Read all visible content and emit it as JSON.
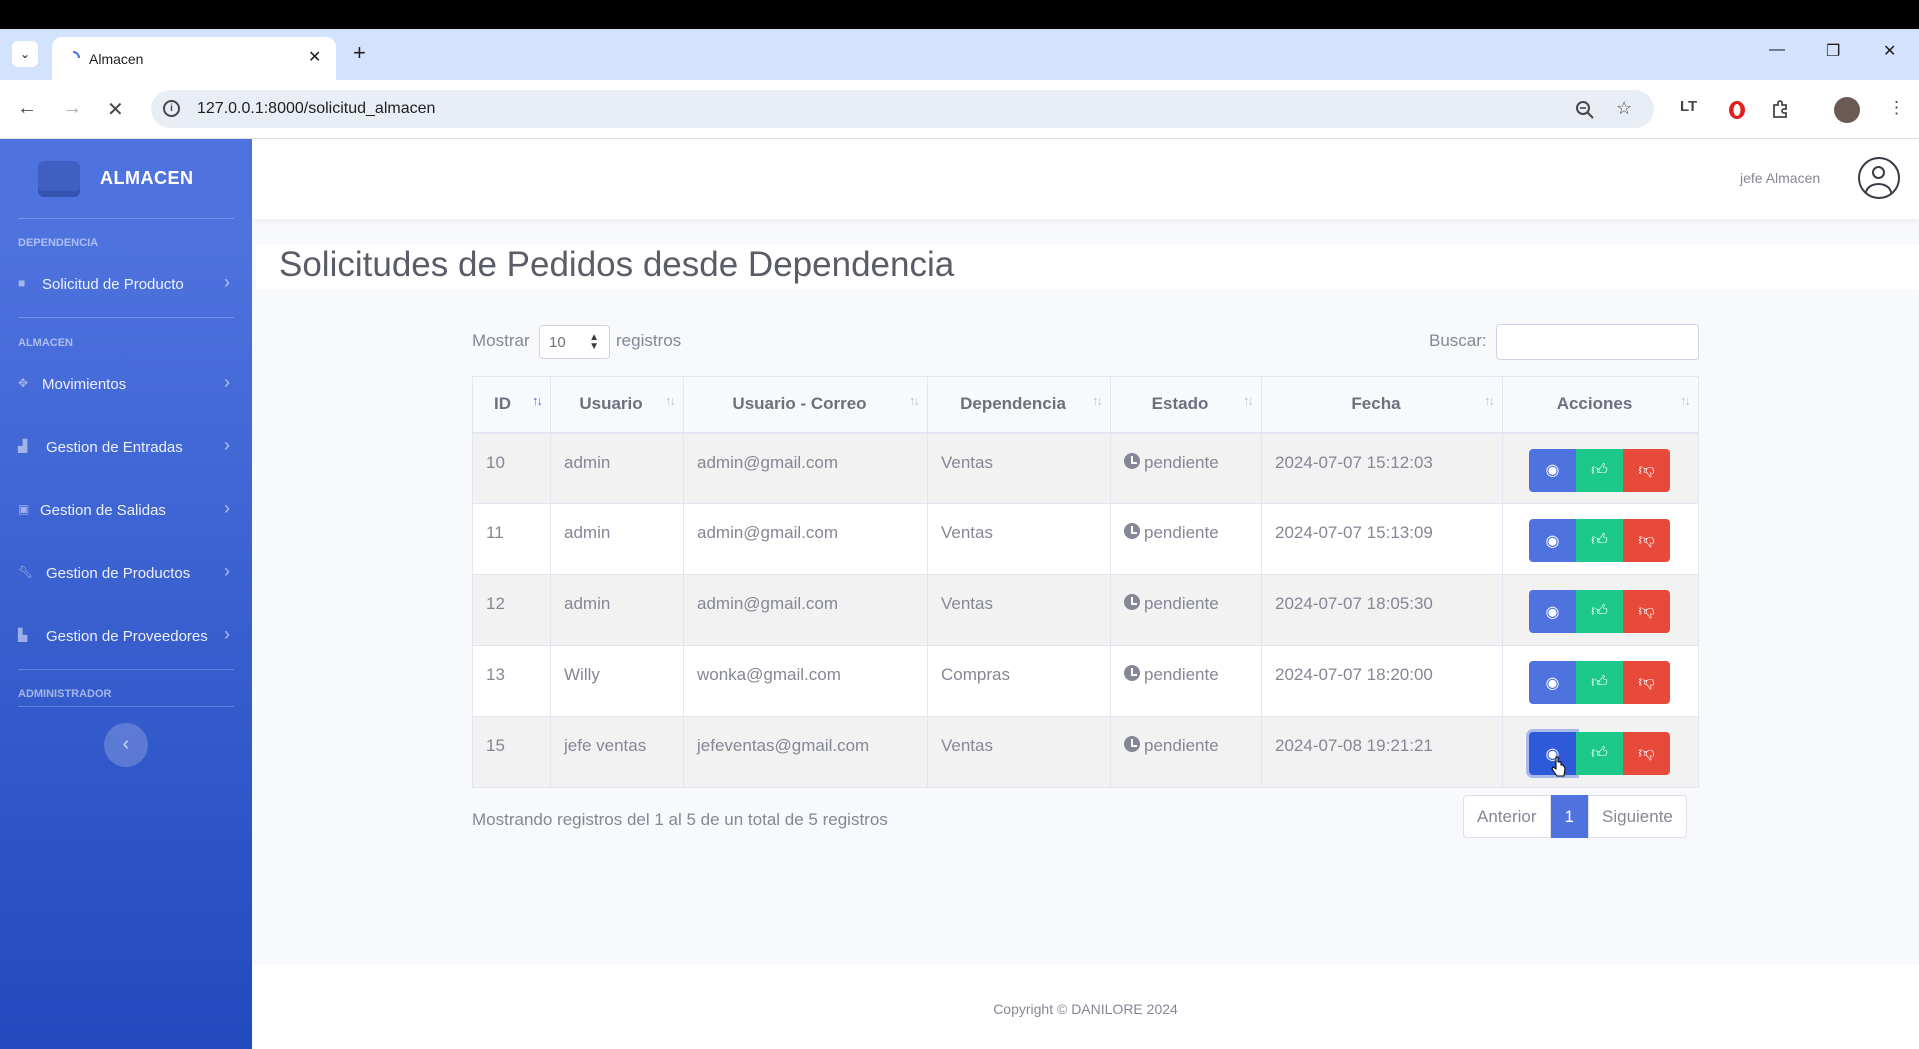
{
  "browser": {
    "tab_title": "Almacen",
    "url": "127.0.0.1:8000/solicitud_almacen"
  },
  "sidebar": {
    "brand": "ALMACEN",
    "sections": [
      {
        "heading": "DEPENDENCIA",
        "items": [
          "Solicitud de Producto"
        ]
      },
      {
        "heading": "ALMACEN",
        "items": [
          "Movimientos",
          "Gestion de Entradas",
          "Gestion de Salidas",
          "Gestion de Productos",
          "Gestion de Proveedores"
        ]
      },
      {
        "heading": "ADMINISTRADOR",
        "items": []
      }
    ]
  },
  "topbar": {
    "user_name": "jefe Almacen"
  },
  "page_title": "Solicitudes de Pedidos desde Dependencia",
  "datatable": {
    "length_prefix": "Mostrar",
    "length_value": "10",
    "length_suffix": "registros",
    "search_label": "Buscar:",
    "columns": [
      "ID",
      "Usuario",
      "Usuario - Correo",
      "Dependencia",
      "Estado",
      "Fecha",
      "Acciones"
    ],
    "rows": [
      {
        "id": "10",
        "usuario": "admin",
        "correo": "admin@gmail.com",
        "dependencia": "Ventas",
        "estado": "pendiente",
        "fecha": "2024-07-07 15:12:03"
      },
      {
        "id": "11",
        "usuario": "admin",
        "correo": "admin@gmail.com",
        "dependencia": "Ventas",
        "estado": "pendiente",
        "fecha": "2024-07-07 15:13:09"
      },
      {
        "id": "12",
        "usuario": "admin",
        "correo": "admin@gmail.com",
        "dependencia": "Ventas",
        "estado": "pendiente",
        "fecha": "2024-07-07 18:05:30"
      },
      {
        "id": "13",
        "usuario": "Willy",
        "correo": "wonka@gmail.com",
        "dependencia": "Compras",
        "estado": "pendiente",
        "fecha": "2024-07-07 18:20:00"
      },
      {
        "id": "15",
        "usuario": "jefe ventas",
        "correo": "jefeventas@gmail.com",
        "dependencia": "Ventas",
        "estado": "pendiente",
        "fecha": "2024-07-08 19:21:21"
      }
    ],
    "info": "Mostrando registros del 1 al 5 de un total de 5 registros",
    "pagination": {
      "prev": "Anterior",
      "current": "1",
      "next": "Siguiente"
    }
  },
  "footer": {
    "copyright": "Copyright © DANILORE 2024"
  },
  "colors": {
    "primary": "#4e73df",
    "success": "#1cc88a",
    "danger": "#e74a3b",
    "text_muted": "#858796"
  }
}
